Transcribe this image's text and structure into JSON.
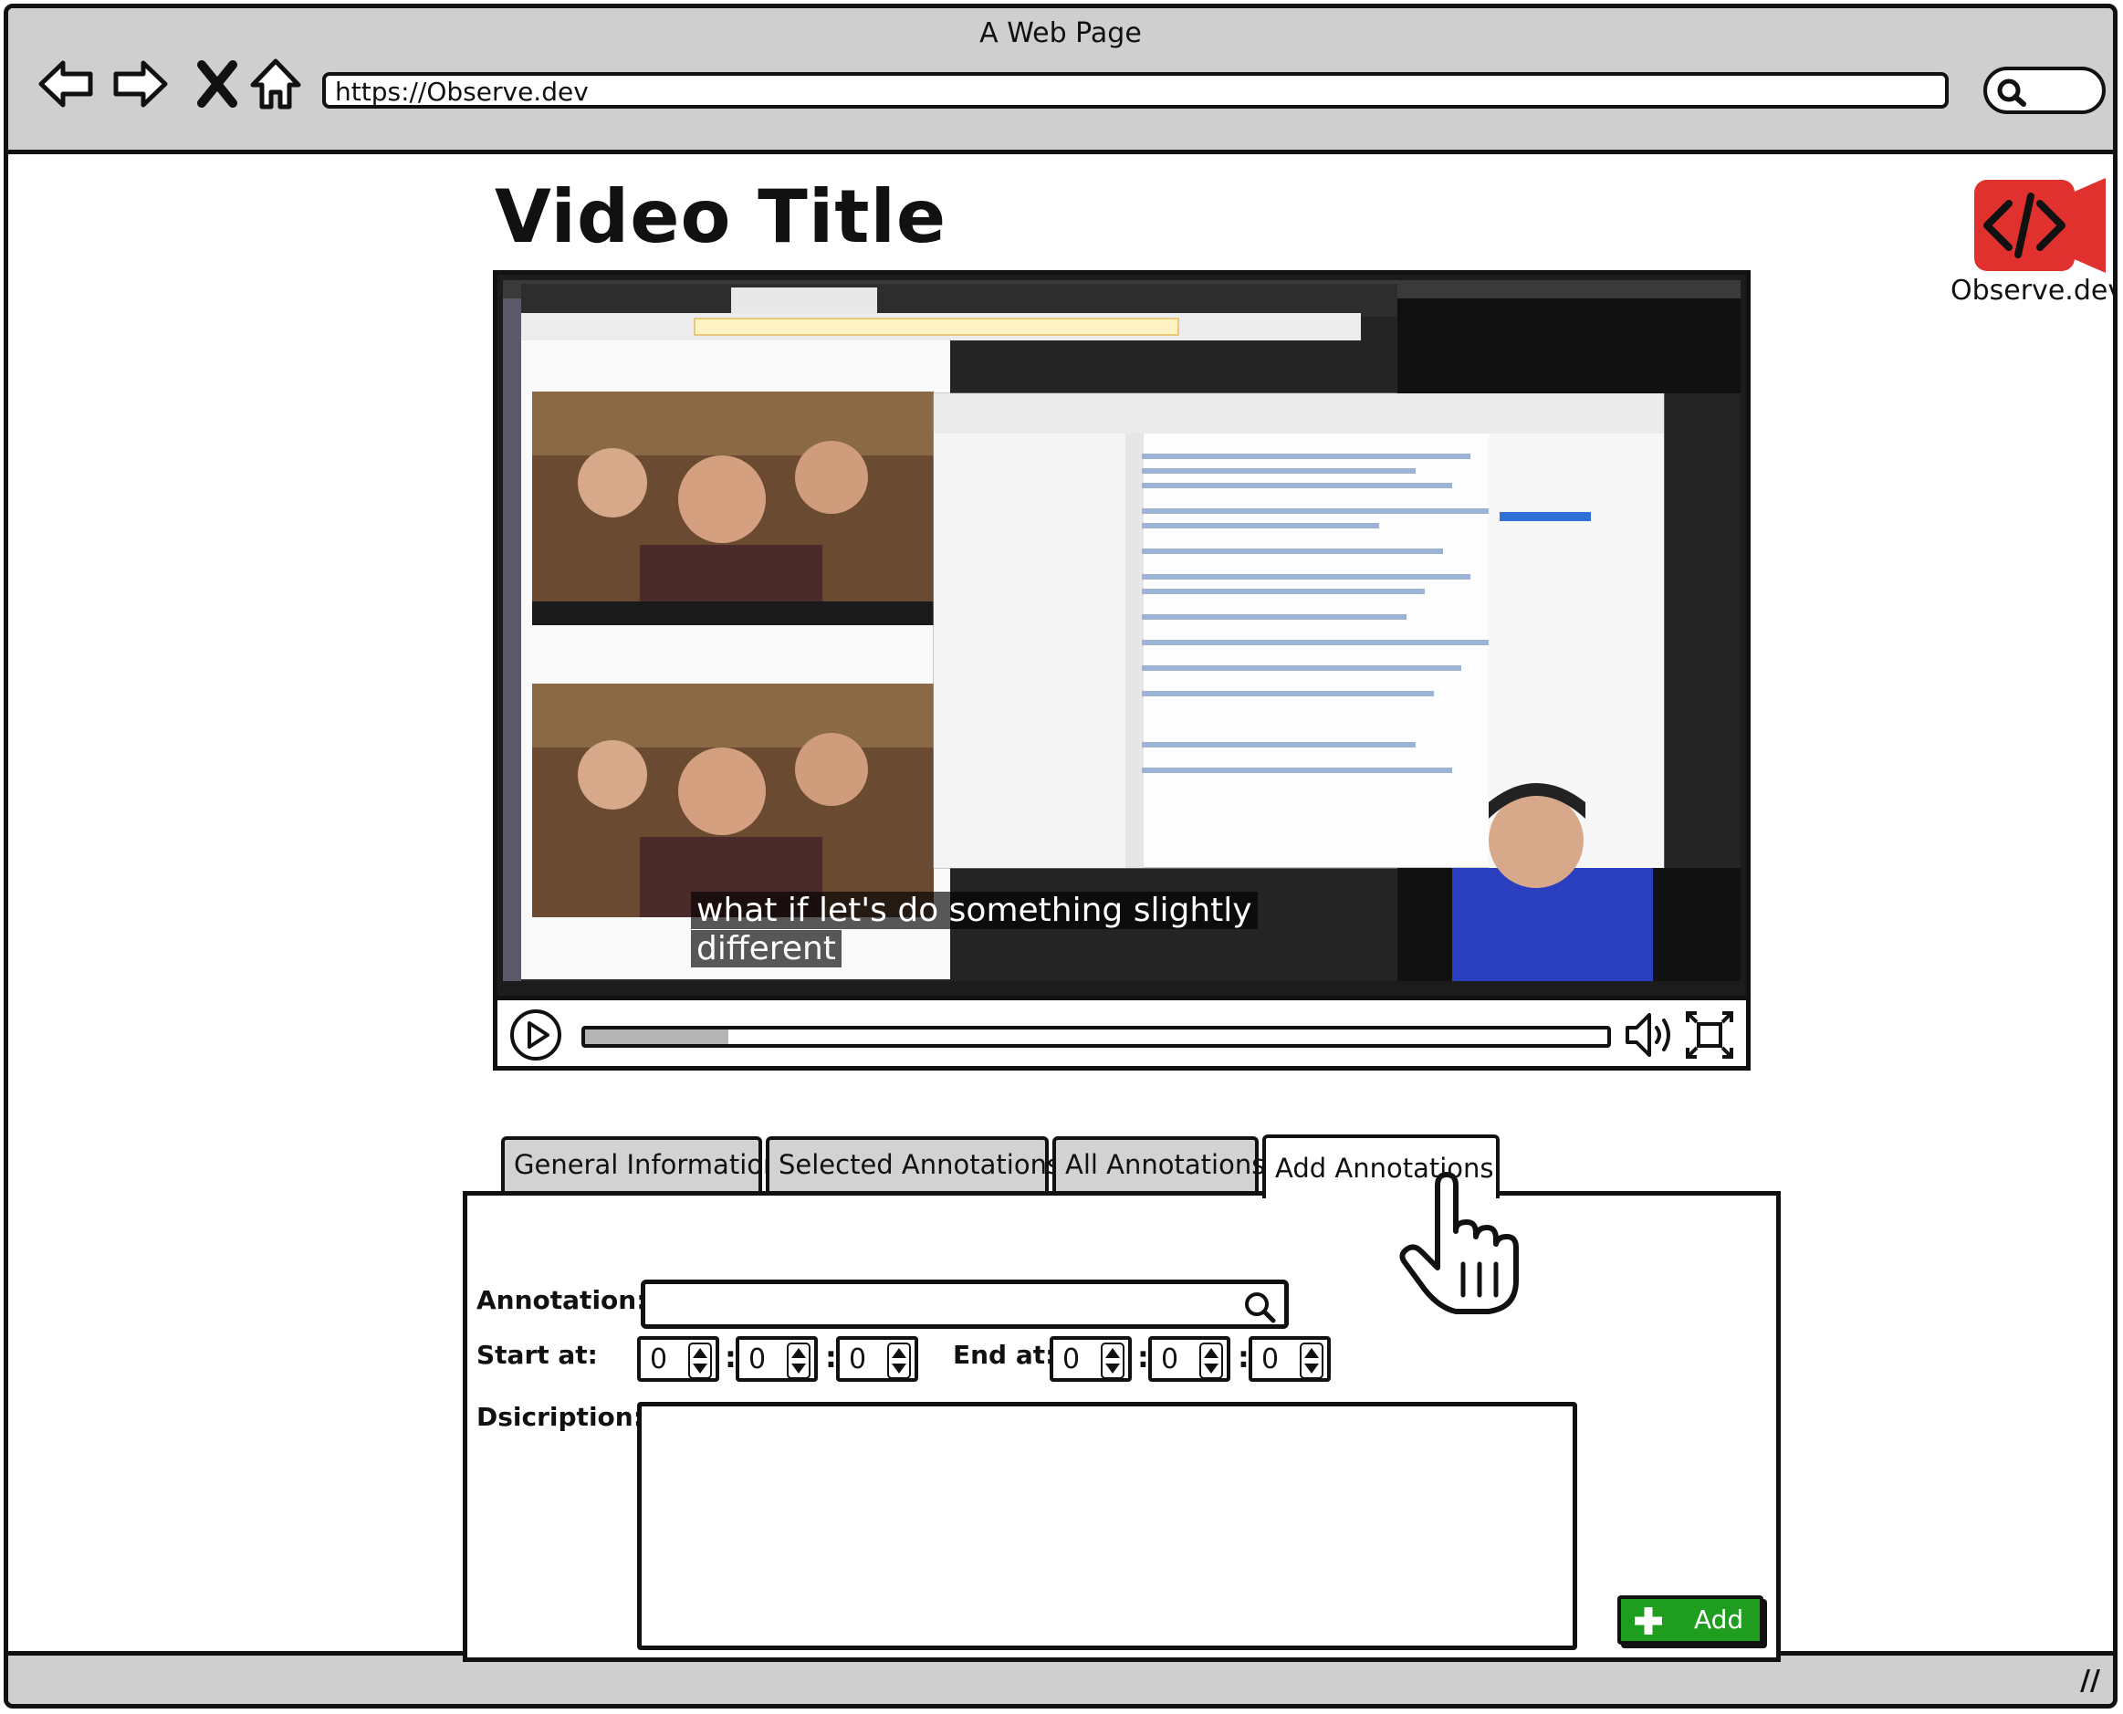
{
  "browser": {
    "window_title": "A Web Page",
    "url": "https://Observe.dev"
  },
  "page": {
    "title": "Video Title",
    "brand_name": "Observe.dev",
    "brand_color": "#e0312f"
  },
  "video": {
    "caption_line1": "what if let's do something slightly",
    "caption_line2": "different",
    "progress": 0.14
  },
  "tabs": [
    {
      "label": "General Information",
      "active": false
    },
    {
      "label": "Selected Annotations",
      "active": false
    },
    {
      "label": "All Annotations",
      "active": false
    },
    {
      "label": "Add Annotations",
      "active": true
    }
  ],
  "form": {
    "annotation_label": "Annotation:",
    "annotation_value": "",
    "start_label": "Start at:",
    "end_label": "End at:",
    "start": {
      "h": "0",
      "m": "0",
      "s": "0"
    },
    "end": {
      "h": "0",
      "m": "0",
      "s": "0"
    },
    "description_label": "Dsicription:",
    "description_value": "",
    "add_label": "Add",
    "add_color": "#1f9d1f"
  }
}
